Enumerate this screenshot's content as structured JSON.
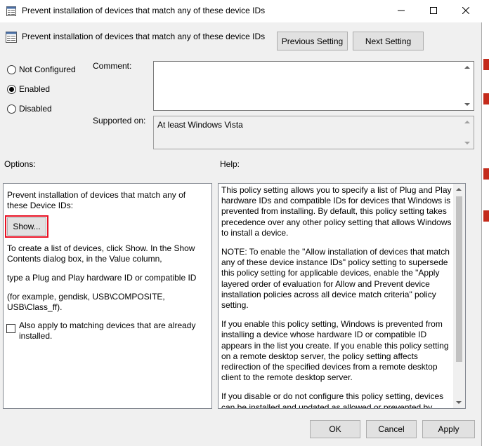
{
  "window": {
    "title": "Prevent installation of devices that match any of these device IDs",
    "controls": {
      "minimize_icon": "minimize-icon",
      "maximize_icon": "maximize-icon",
      "close_icon": "close-icon"
    }
  },
  "header": {
    "title": "Prevent installation of devices that match  any of these device IDs",
    "previous_setting": "Previous Setting",
    "next_setting": "Next Setting"
  },
  "state": {
    "options": [
      {
        "label": "Not Configured",
        "checked": false
      },
      {
        "label": "Enabled",
        "checked": true
      },
      {
        "label": "Disabled",
        "checked": false
      }
    ]
  },
  "comment": {
    "label": "Comment:",
    "value": ""
  },
  "supported_on": {
    "label": "Supported on:",
    "value": "At least Windows Vista"
  },
  "options_section": {
    "label": "Options:",
    "description": "Prevent installation of devices that match any of these Device IDs:",
    "show_button": "Show...",
    "instructions": [
      "To create a list of devices, click Show. In the Show Contents dialog box, in the Value column,",
      "type a Plug and Play hardware ID or compatible ID",
      "(for example, gendisk, USB\\COMPOSITE, USB\\Class_ff)."
    ],
    "checkbox": {
      "label": "Also apply to matching devices that are already installed.",
      "checked": false
    }
  },
  "help_section": {
    "label": "Help:",
    "paragraphs": [
      "This policy setting allows you to specify a list of Plug and Play hardware IDs and compatible IDs for devices that Windows is prevented from installing. By default, this policy setting takes precedence over any other policy setting that allows Windows to install a device.",
      "NOTE: To enable the \"Allow installation of devices that match any of these device instance IDs\" policy setting to supersede this policy setting for applicable devices, enable the \"Apply layered order of evaluation for Allow and Prevent device installation policies across all device match criteria\" policy setting.",
      "If you enable this policy setting, Windows is prevented from installing a device whose hardware ID or compatible ID appears in the list you create. If you enable this policy setting on a remote desktop server, the policy setting affects redirection of the specified devices from a remote desktop client to the remote desktop server.",
      "If you disable or do not configure this policy setting, devices can be installed and updated as allowed or prevented by other policy settings."
    ]
  },
  "footer": {
    "ok": "OK",
    "cancel": "Cancel",
    "apply": "Apply"
  },
  "colors": {
    "highlight_border": "#e81123",
    "window_bg": "#f0f0f0",
    "button_bg": "#e1e1e1"
  }
}
